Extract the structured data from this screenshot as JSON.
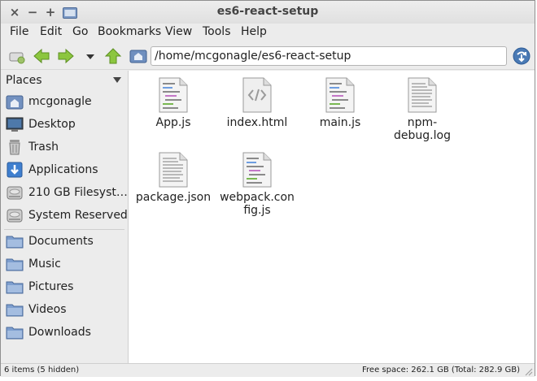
{
  "window": {
    "title": "es6-react-setup",
    "controls": {
      "close": "×",
      "minimize": "−",
      "maximize": "+"
    }
  },
  "menu": [
    "File",
    "Edit",
    "Go",
    "Bookmarks",
    "View",
    "Tools",
    "Help"
  ],
  "toolbar": {
    "address": "/home/mcgonagle/es6-react-setup",
    "buttons": [
      "new-tab-icon",
      "back-arrow-icon",
      "forward-arrow-icon",
      "history-dropdown-icon",
      "up-arrow-icon",
      "home-folder-icon",
      "go-refresh-icon"
    ]
  },
  "sidebar": {
    "header": "Places",
    "places": [
      {
        "label": "mcgonagle",
        "icon": "home-icon"
      },
      {
        "label": "Desktop",
        "icon": "desktop-icon"
      },
      {
        "label": "Trash",
        "icon": "trash-icon"
      },
      {
        "label": "Applications",
        "icon": "applications-icon"
      },
      {
        "label": "210 GB Filesyst…",
        "icon": "drive-icon"
      },
      {
        "label": "System Reserved",
        "icon": "drive-icon"
      }
    ],
    "bookmarks": [
      {
        "label": "Documents",
        "icon": "folder-icon"
      },
      {
        "label": "Music",
        "icon": "folder-icon"
      },
      {
        "label": "Pictures",
        "icon": "folder-icon"
      },
      {
        "label": "Videos",
        "icon": "folder-icon"
      },
      {
        "label": "Downloads",
        "icon": "folder-icon"
      }
    ]
  },
  "files": [
    {
      "name": "App.js",
      "icon": "script-file-icon"
    },
    {
      "name": "index.html",
      "icon": "html-file-icon"
    },
    {
      "name": "main.js",
      "icon": "script-file-icon"
    },
    {
      "name": "npm-debug.log",
      "icon": "text-file-icon"
    },
    {
      "name": "package.json",
      "icon": "text-file-icon"
    },
    {
      "name": "webpack.config.js",
      "icon": "script-file-icon"
    }
  ],
  "status": {
    "items": "6 items (5 hidden)",
    "free_space": "Free space: 262.1 GB (Total: 282.9 GB)"
  },
  "colors": {
    "accent_blue": "#4a7ab5",
    "arrow_green": "#7bb733",
    "folder_blue": "#6e93c8"
  }
}
